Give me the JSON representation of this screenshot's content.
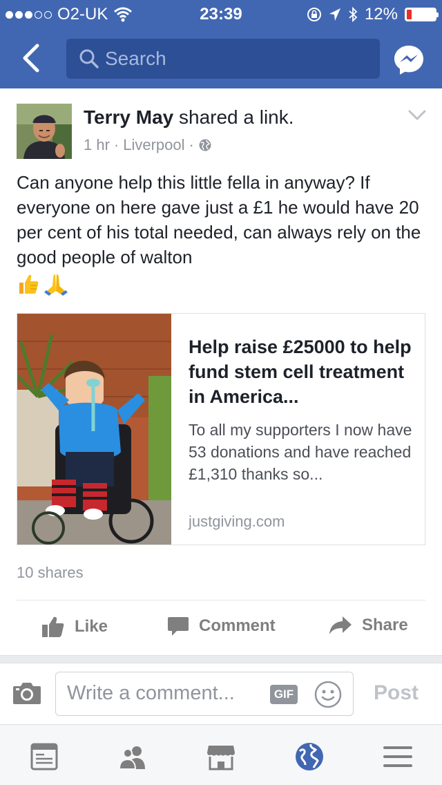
{
  "status_bar": {
    "carrier": "O2-UK",
    "time": "23:39",
    "battery": "12%",
    "battery_level": 0.12
  },
  "nav": {
    "search_placeholder": "Search",
    "back_icon": "chevron-left-icon",
    "messenger_icon": "messenger-icon"
  },
  "post": {
    "author": "Terry May",
    "action": "shared a link.",
    "time": "1 hr",
    "location": "Liverpool",
    "separator": "·",
    "privacy_icon": "globe-icon",
    "text": "Can anyone help this little fella in anyway? If everyone on here gave just a £1 he would have 20 per cent of his total needed, can always rely on the good people of walton",
    "emojis": [
      "thumbs-up-icon",
      "praying-hands-icon"
    ],
    "link": {
      "title": "Help raise £25000 to help fund stem cell treatment in America...",
      "description": "To all my supporters I now have 53 donations and have reached £1,310 thanks so...",
      "domain": "justgiving.com"
    },
    "shares": "10 shares"
  },
  "actions": {
    "like": "Like",
    "comment": "Comment",
    "share": "Share"
  },
  "composer": {
    "placeholder": "Write a comment...",
    "gif_label": "GIF",
    "post_label": "Post"
  },
  "tabs": [
    "news-feed-icon",
    "friends-icon",
    "marketplace-icon",
    "notifications-globe-icon",
    "menu-icon"
  ],
  "colors": {
    "brand_blue": "#4267b2",
    "search_bg": "#2c4f96",
    "text_dark": "#1d2129",
    "text_muted": "#90949c",
    "active_tab": "#4267b2"
  }
}
